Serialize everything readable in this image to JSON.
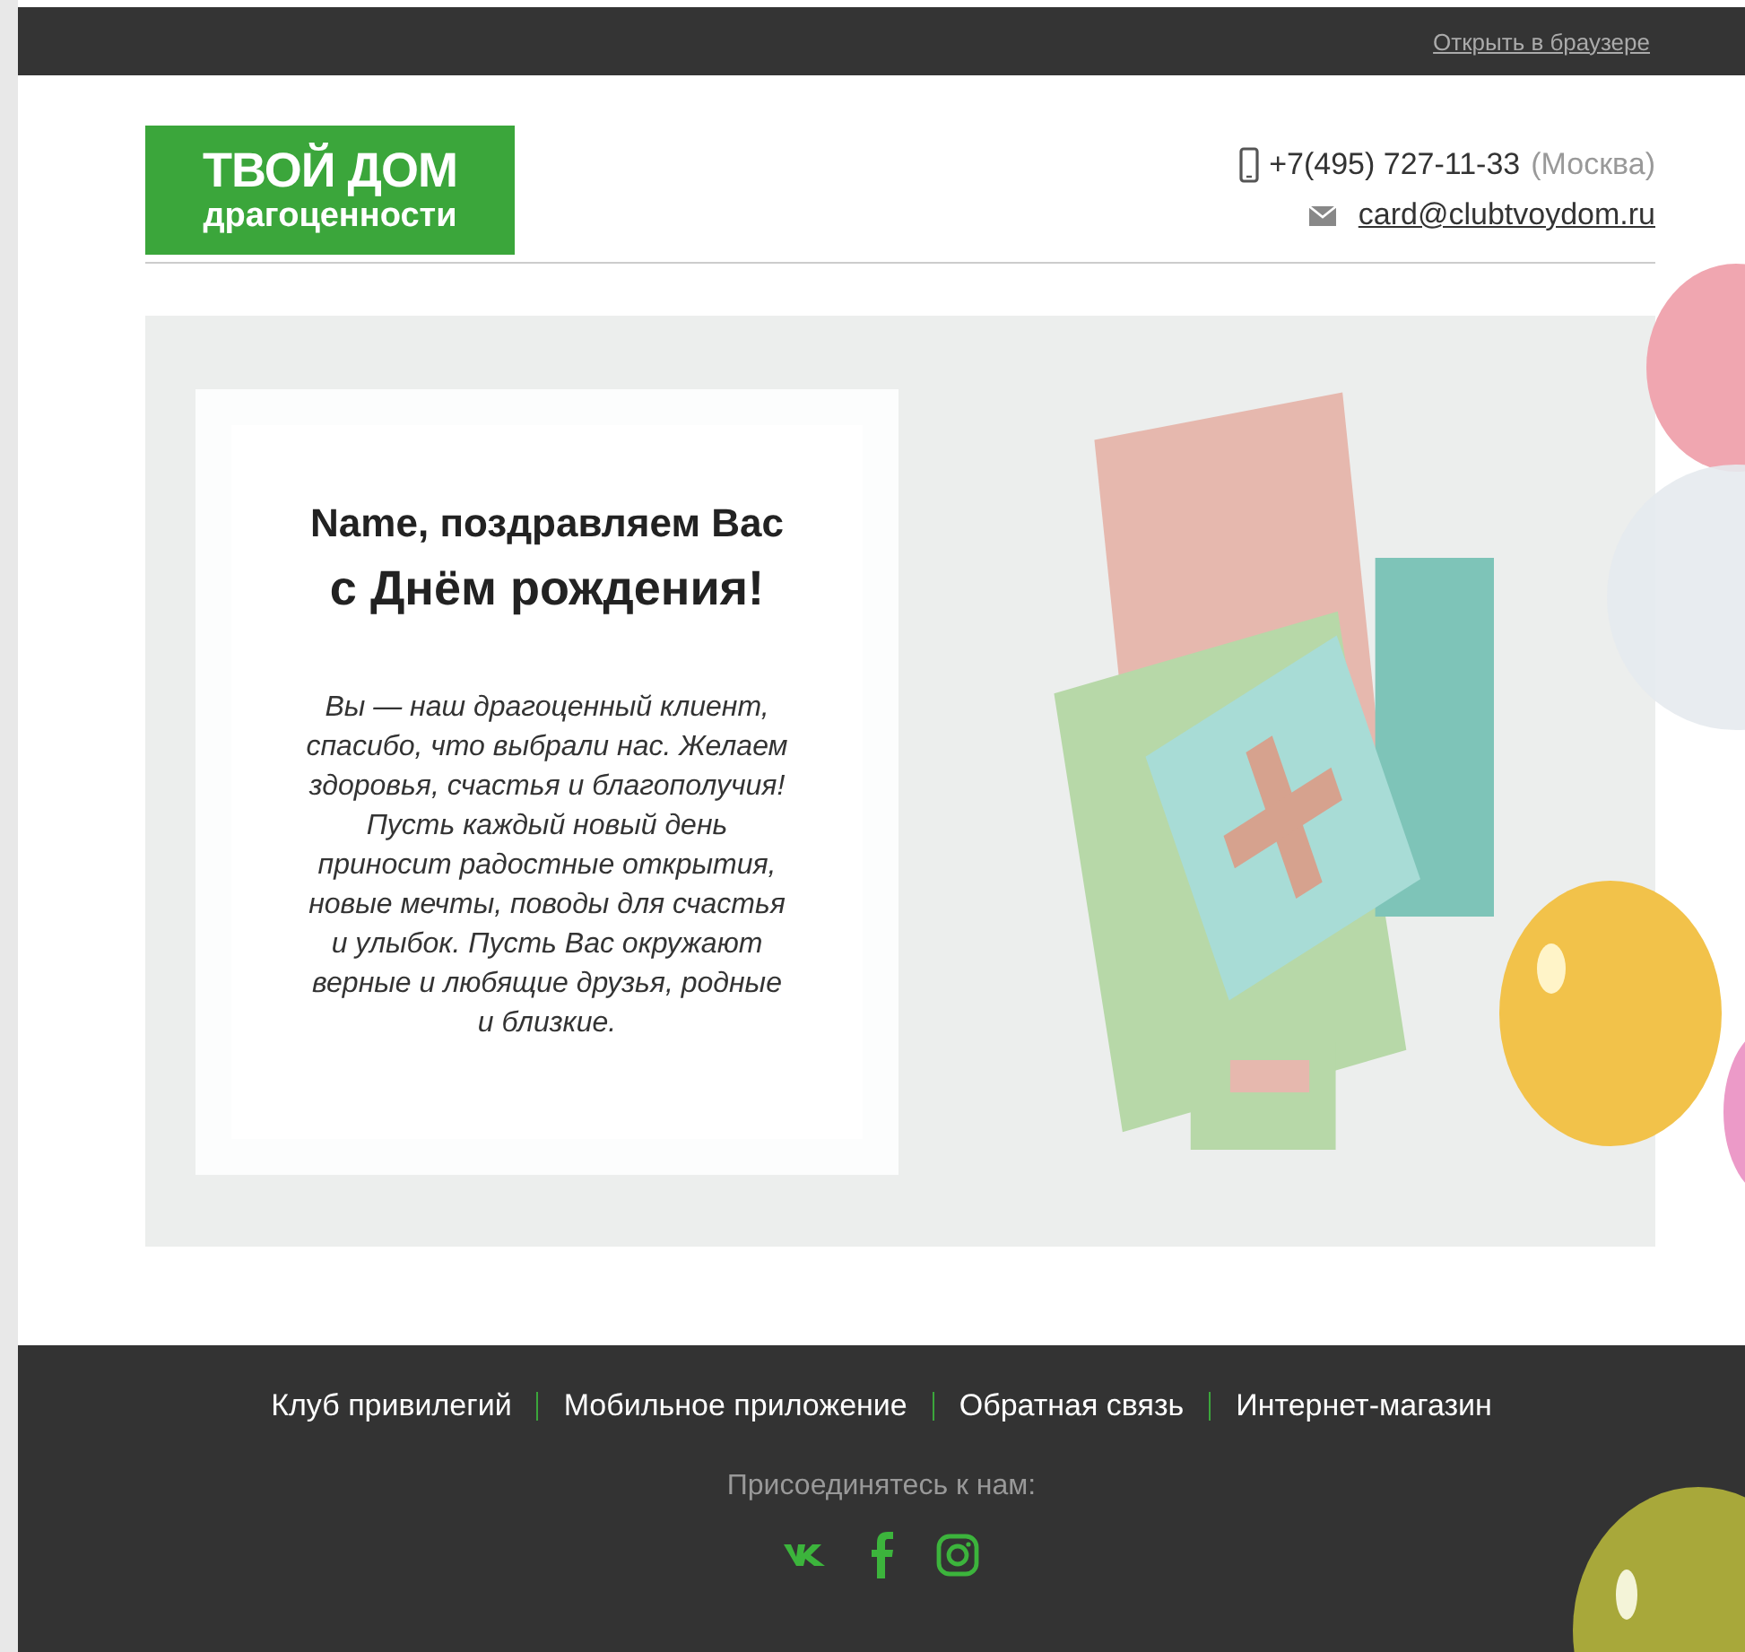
{
  "top_bar": {
    "open_in_browser": "Открыть в браузере"
  },
  "header": {
    "logo": {
      "title": "ТВОЙ ДОМ",
      "subtitle": "драгоценности"
    },
    "phone": "+7(495) 727-11-33",
    "city": "(Москва)",
    "email": "card@clubtvoydom.ru"
  },
  "greeting": {
    "heading_line_1": "Name, поздравляем Вас",
    "heading_line_2": "с Днём рождения!",
    "message": "Вы — наш драгоценный клиент, спасибо, что выбрали нас. Желаем здоровья, счастья и благополучия! Пусть каждый новый день приносит радостные открытия, новые мечты, поводы для счастья и улыбок. Пусть Вас окружают верные и любящие друзья, родные и близкие."
  },
  "footer": {
    "links": [
      "Клуб привилегий",
      "Мобильное приложение",
      "Обратная связь",
      "Интернет-магазин"
    ],
    "join_label": "Присоединятесь к нам:"
  }
}
